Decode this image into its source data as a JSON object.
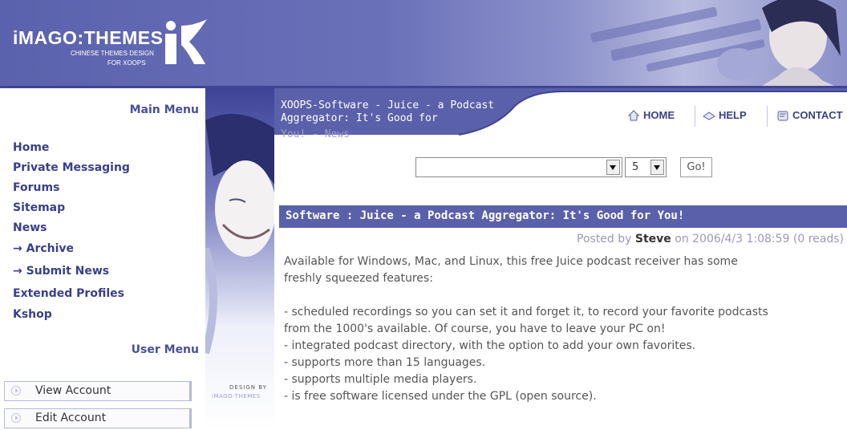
{
  "header": {
    "logo_title": "iMAGO:THEMES",
    "logo_sub1": "CHINESE THEMES DESIGN",
    "logo_sub2": "FOR XOOPS"
  },
  "sidebar": {
    "main_menu_title": "Main Menu",
    "main_menu": [
      "Home",
      "Private Messaging",
      "Forums",
      "Sitemap",
      "News",
      "→ Archive",
      "→ Submit News",
      "Extended Profiles",
      "Kshop"
    ],
    "user_menu_title": "User Menu",
    "user_menu": [
      "View Account",
      "Edit Account"
    ],
    "design_by": "DESIGN BY",
    "design_brand": "iMAGO·THEMES"
  },
  "content": {
    "page_title": "XOOPS-Software - Juice - a Podcast Aggregator: It's Good for",
    "page_title_tail": "You! - News",
    "top_links": {
      "home": "HOME",
      "help": "HELP",
      "contact": "CONTACT"
    },
    "topic_select_value": "",
    "count_select_value": "5",
    "go_label": "Go!",
    "article": {
      "title": "Software : Juice - a Podcast Aggregator: It's Good for You!",
      "posted_prefix": "Posted by",
      "author": "Steve",
      "posted_suffix": "on 2006/4/3 1:08:59 (0 reads)",
      "paragraphs": [
        "Available for Windows, Mac, and Linux, this free Juice podcast receiver has some",
        "freshly squeezed features:",
        "",
        "- scheduled recordings so you can set it and forget it, to record your favorite podcasts",
        "from the 1000's available. Of course, you have to leave your PC on!",
        "- integrated podcast directory, with the option to add your own favorites.",
        "- supports more than 15 languages.",
        "- supports multiple media players.",
        "- is free software licensed under the GPL (open source)."
      ]
    }
  },
  "colors": {
    "banner": "#5b62ad",
    "title_bar": "#5a60aa",
    "nav_text": "#3a3f8a"
  }
}
